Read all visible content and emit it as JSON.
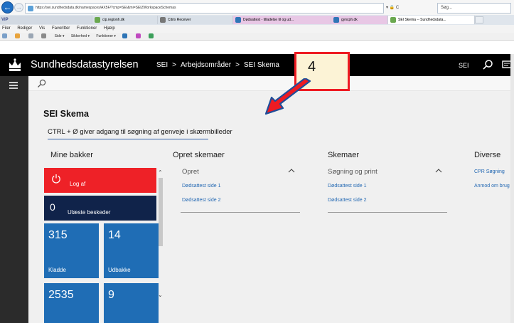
{
  "browser": {
    "address": "https://sei.sundhedsdata.dk/namespaces/AX5F/?cmp=SEI&mi=SEIZWorkspaceSchemas",
    "address_tools": "▾ 🔒 C",
    "search_placeholder": "Søg...",
    "tabs": [
      {
        "label": "VIP"
      },
      {
        "label": "cip.regionh.dk"
      },
      {
        "label": "Citrix Receiver"
      },
      {
        "label": "Dødsattest - tilladelse til og ud..."
      },
      {
        "label": "gyncph.dk"
      },
      {
        "label": "SEI Skema -- Sundhedsdata..."
      }
    ],
    "menu": [
      "Filer",
      "Rediger",
      "Vis",
      "Favoritter",
      "Funktioner",
      "Hjælp"
    ],
    "commands": [
      "Side ▾",
      "Sikkerhed ▾",
      "Funktioner ▾"
    ]
  },
  "header": {
    "title": "Sundhedsdatastyrelsen",
    "crumb_1": "SEI",
    "crumb_2": "Arbejdsområder",
    "crumb_3": "SEI Skema",
    "crumb_sep": ">",
    "user": "SEI"
  },
  "page": {
    "title": "SEI Skema",
    "shortcut_tip": "CTRL + Ø giver adgang til søgning af genveje i skærmbilleder"
  },
  "columns": {
    "mine_bakker": "Mine bakker",
    "opret_skemaer": "Opret skemaer",
    "skemaer": "Skemaer",
    "diverse": "Diverse"
  },
  "tiles": {
    "logoff_label": "Log af",
    "unread_count": "0",
    "unread_label": "Ulæste beskeder",
    "kladde_count": "315",
    "kladde_label": "Kladde",
    "udbakke_count": "14",
    "udbakke_label": "Udbakke",
    "tile3_count": "2535",
    "tile4_count": "9"
  },
  "opret": {
    "section": "Opret",
    "links": [
      "Dødsattest side 1",
      "Dødsattest side 2"
    ]
  },
  "skemaer": {
    "section": "Søgning og print",
    "links": [
      "Dødsattest side 1",
      "Dødsattest side 2"
    ]
  },
  "diverse": {
    "links": [
      "CPR Søgning",
      "Anmod om brug"
    ]
  },
  "annotation": {
    "step": "4"
  },
  "colors": {
    "header_bg": "#000000",
    "logoff_tile": "#ee2127",
    "unread_tile": "#10234a",
    "count_tile": "#1f6db5",
    "link": "#2469b3",
    "annotation_border": "#ee1b22"
  }
}
